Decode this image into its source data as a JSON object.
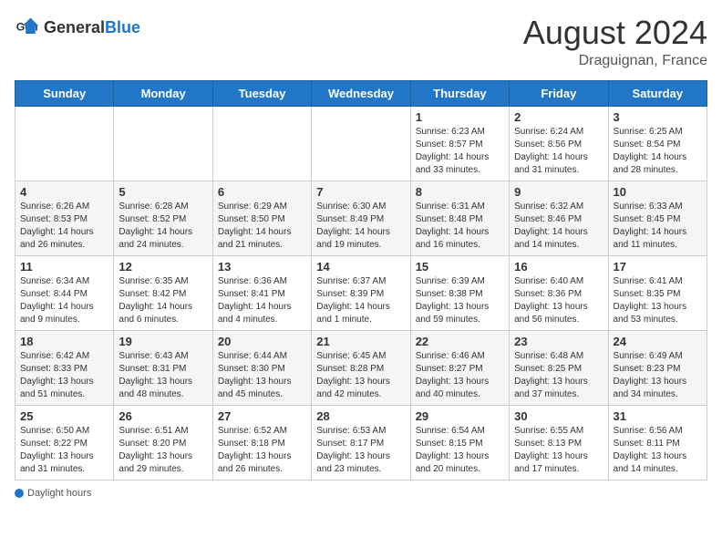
{
  "header": {
    "logo_general": "General",
    "logo_blue": "Blue",
    "month_year": "August 2024",
    "location": "Draguignan, France"
  },
  "days_of_week": [
    "Sunday",
    "Monday",
    "Tuesday",
    "Wednesday",
    "Thursday",
    "Friday",
    "Saturday"
  ],
  "legend": {
    "daylight_hours": "Daylight hours"
  },
  "weeks": [
    [
      {
        "day": "",
        "sunrise": "",
        "sunset": "",
        "daylight": ""
      },
      {
        "day": "",
        "sunrise": "",
        "sunset": "",
        "daylight": ""
      },
      {
        "day": "",
        "sunrise": "",
        "sunset": "",
        "daylight": ""
      },
      {
        "day": "",
        "sunrise": "",
        "sunset": "",
        "daylight": ""
      },
      {
        "day": "1",
        "sunrise": "Sunrise: 6:23 AM",
        "sunset": "Sunset: 8:57 PM",
        "daylight": "Daylight: 14 hours and 33 minutes."
      },
      {
        "day": "2",
        "sunrise": "Sunrise: 6:24 AM",
        "sunset": "Sunset: 8:56 PM",
        "daylight": "Daylight: 14 hours and 31 minutes."
      },
      {
        "day": "3",
        "sunrise": "Sunrise: 6:25 AM",
        "sunset": "Sunset: 8:54 PM",
        "daylight": "Daylight: 14 hours and 28 minutes."
      }
    ],
    [
      {
        "day": "4",
        "sunrise": "Sunrise: 6:26 AM",
        "sunset": "Sunset: 8:53 PM",
        "daylight": "Daylight: 14 hours and 26 minutes."
      },
      {
        "day": "5",
        "sunrise": "Sunrise: 6:28 AM",
        "sunset": "Sunset: 8:52 PM",
        "daylight": "Daylight: 14 hours and 24 minutes."
      },
      {
        "day": "6",
        "sunrise": "Sunrise: 6:29 AM",
        "sunset": "Sunset: 8:50 PM",
        "daylight": "Daylight: 14 hours and 21 minutes."
      },
      {
        "day": "7",
        "sunrise": "Sunrise: 6:30 AM",
        "sunset": "Sunset: 8:49 PM",
        "daylight": "Daylight: 14 hours and 19 minutes."
      },
      {
        "day": "8",
        "sunrise": "Sunrise: 6:31 AM",
        "sunset": "Sunset: 8:48 PM",
        "daylight": "Daylight: 14 hours and 16 minutes."
      },
      {
        "day": "9",
        "sunrise": "Sunrise: 6:32 AM",
        "sunset": "Sunset: 8:46 PM",
        "daylight": "Daylight: 14 hours and 14 minutes."
      },
      {
        "day": "10",
        "sunrise": "Sunrise: 6:33 AM",
        "sunset": "Sunset: 8:45 PM",
        "daylight": "Daylight: 14 hours and 11 minutes."
      }
    ],
    [
      {
        "day": "11",
        "sunrise": "Sunrise: 6:34 AM",
        "sunset": "Sunset: 8:44 PM",
        "daylight": "Daylight: 14 hours and 9 minutes."
      },
      {
        "day": "12",
        "sunrise": "Sunrise: 6:35 AM",
        "sunset": "Sunset: 8:42 PM",
        "daylight": "Daylight: 14 hours and 6 minutes."
      },
      {
        "day": "13",
        "sunrise": "Sunrise: 6:36 AM",
        "sunset": "Sunset: 8:41 PM",
        "daylight": "Daylight: 14 hours and 4 minutes."
      },
      {
        "day": "14",
        "sunrise": "Sunrise: 6:37 AM",
        "sunset": "Sunset: 8:39 PM",
        "daylight": "Daylight: 14 hours and 1 minute."
      },
      {
        "day": "15",
        "sunrise": "Sunrise: 6:39 AM",
        "sunset": "Sunset: 8:38 PM",
        "daylight": "Daylight: 13 hours and 59 minutes."
      },
      {
        "day": "16",
        "sunrise": "Sunrise: 6:40 AM",
        "sunset": "Sunset: 8:36 PM",
        "daylight": "Daylight: 13 hours and 56 minutes."
      },
      {
        "day": "17",
        "sunrise": "Sunrise: 6:41 AM",
        "sunset": "Sunset: 8:35 PM",
        "daylight": "Daylight: 13 hours and 53 minutes."
      }
    ],
    [
      {
        "day": "18",
        "sunrise": "Sunrise: 6:42 AM",
        "sunset": "Sunset: 8:33 PM",
        "daylight": "Daylight: 13 hours and 51 minutes."
      },
      {
        "day": "19",
        "sunrise": "Sunrise: 6:43 AM",
        "sunset": "Sunset: 8:31 PM",
        "daylight": "Daylight: 13 hours and 48 minutes."
      },
      {
        "day": "20",
        "sunrise": "Sunrise: 6:44 AM",
        "sunset": "Sunset: 8:30 PM",
        "daylight": "Daylight: 13 hours and 45 minutes."
      },
      {
        "day": "21",
        "sunrise": "Sunrise: 6:45 AM",
        "sunset": "Sunset: 8:28 PM",
        "daylight": "Daylight: 13 hours and 42 minutes."
      },
      {
        "day": "22",
        "sunrise": "Sunrise: 6:46 AM",
        "sunset": "Sunset: 8:27 PM",
        "daylight": "Daylight: 13 hours and 40 minutes."
      },
      {
        "day": "23",
        "sunrise": "Sunrise: 6:48 AM",
        "sunset": "Sunset: 8:25 PM",
        "daylight": "Daylight: 13 hours and 37 minutes."
      },
      {
        "day": "24",
        "sunrise": "Sunrise: 6:49 AM",
        "sunset": "Sunset: 8:23 PM",
        "daylight": "Daylight: 13 hours and 34 minutes."
      }
    ],
    [
      {
        "day": "25",
        "sunrise": "Sunrise: 6:50 AM",
        "sunset": "Sunset: 8:22 PM",
        "daylight": "Daylight: 13 hours and 31 minutes."
      },
      {
        "day": "26",
        "sunrise": "Sunrise: 6:51 AM",
        "sunset": "Sunset: 8:20 PM",
        "daylight": "Daylight: 13 hours and 29 minutes."
      },
      {
        "day": "27",
        "sunrise": "Sunrise: 6:52 AM",
        "sunset": "Sunset: 8:18 PM",
        "daylight": "Daylight: 13 hours and 26 minutes."
      },
      {
        "day": "28",
        "sunrise": "Sunrise: 6:53 AM",
        "sunset": "Sunset: 8:17 PM",
        "daylight": "Daylight: 13 hours and 23 minutes."
      },
      {
        "day": "29",
        "sunrise": "Sunrise: 6:54 AM",
        "sunset": "Sunset: 8:15 PM",
        "daylight": "Daylight: 13 hours and 20 minutes."
      },
      {
        "day": "30",
        "sunrise": "Sunrise: 6:55 AM",
        "sunset": "Sunset: 8:13 PM",
        "daylight": "Daylight: 13 hours and 17 minutes."
      },
      {
        "day": "31",
        "sunrise": "Sunrise: 6:56 AM",
        "sunset": "Sunset: 8:11 PM",
        "daylight": "Daylight: 13 hours and 14 minutes."
      }
    ]
  ]
}
